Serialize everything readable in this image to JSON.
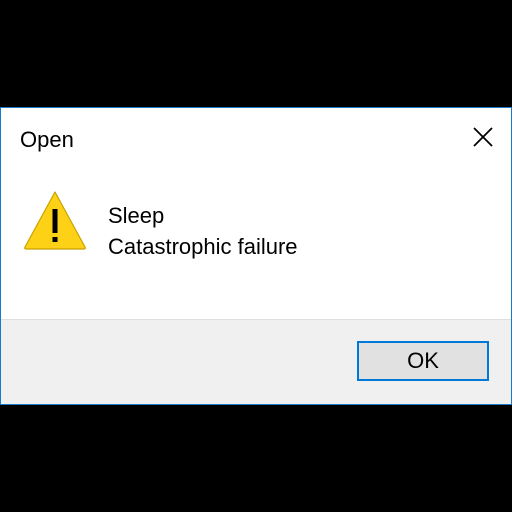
{
  "dialog": {
    "title": "Open",
    "messages": [
      "Sleep",
      "Catastrophic failure"
    ],
    "icon": "warning-icon",
    "ok_label": "OK",
    "colors": {
      "border": "#1979ca",
      "footer_bg": "#f0f0f0",
      "button_bg": "#e1e1e1",
      "button_focus_border": "#0078d7",
      "warning_fill": "#fcd116",
      "background_outside": "#000000"
    }
  }
}
